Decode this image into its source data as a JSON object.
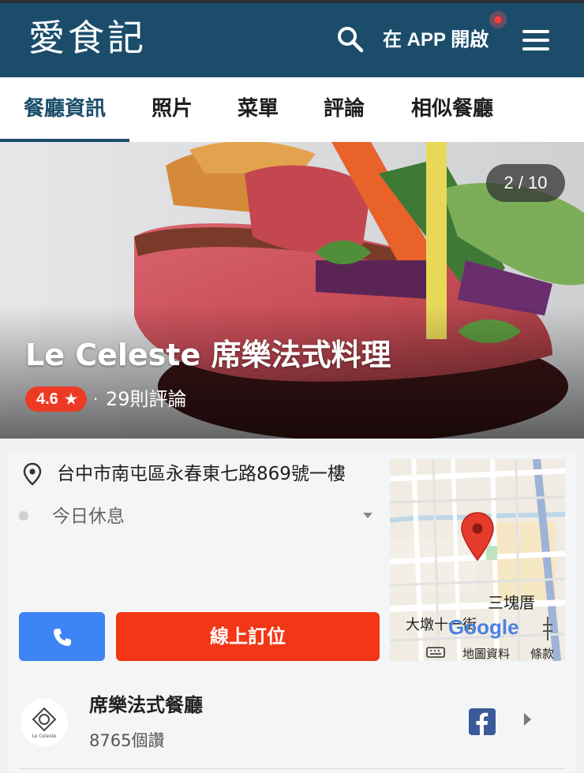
{
  "header": {
    "logo": "愛食記",
    "open_app_label": "在 APP 開啟",
    "colors": {
      "header_bg": "#1b4d6b",
      "accent_red": "#f23616",
      "call_blue": "#3e84f4"
    }
  },
  "tabs": [
    {
      "label": "餐廳資訊",
      "active": true
    },
    {
      "label": "照片",
      "active": false
    },
    {
      "label": "菜單",
      "active": false
    },
    {
      "label": "評論",
      "active": false
    },
    {
      "label": "相似餐廳",
      "active": false
    }
  ],
  "hero": {
    "photo_counter": "2 / 10",
    "restaurant_name": "Le Celeste 席樂法式料理",
    "rating": "4.6",
    "rating_star": "★",
    "separator": "·",
    "review_count": "29則評論"
  },
  "info": {
    "address": "台中市南屯區永春東七路869號一樓",
    "hours_status": "今日休息",
    "reserve_label": "線上訂位"
  },
  "map": {
    "place_label": "三塊厝",
    "street_label": "大墩十一街",
    "provider_logo": "Google",
    "data_label": "地圖資料",
    "terms_label": "條款",
    "icons": [
      "keyboard-icon",
      "map-pin-icon"
    ]
  },
  "facebook": {
    "page_name": "席樂法式餐廳",
    "likes": "8765個讚",
    "logo_text": "Le Celeste"
  }
}
